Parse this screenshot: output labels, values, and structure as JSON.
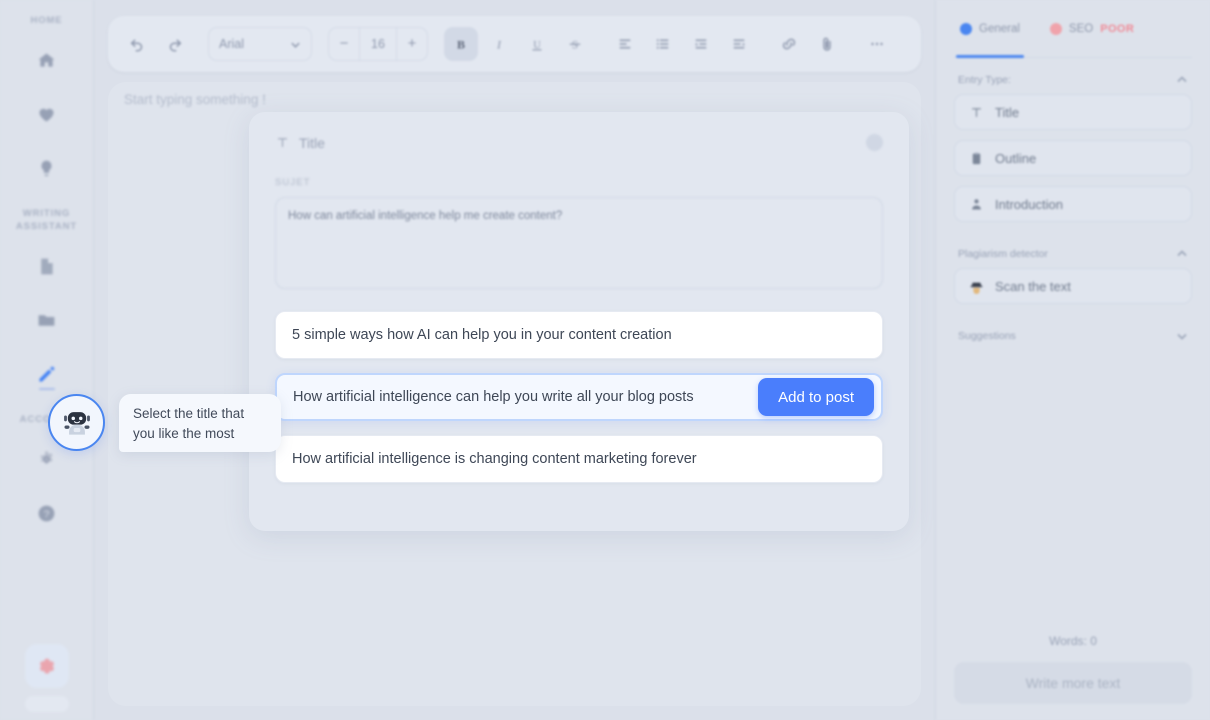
{
  "sidebar": {
    "sections": [
      {
        "label": "HOME",
        "items": [
          {
            "name": "home",
            "icon": "home-icon"
          },
          {
            "name": "favorites",
            "icon": "heart-icon"
          },
          {
            "name": "ideas",
            "icon": "bulb-icon"
          }
        ]
      },
      {
        "label": "WRITING ASSISTANT",
        "items": [
          {
            "name": "documents",
            "icon": "document-icon"
          },
          {
            "name": "folders",
            "icon": "folder-icon"
          },
          {
            "name": "editor",
            "icon": "pencil-icon",
            "active": true
          }
        ]
      },
      {
        "label": "ACCOUNT",
        "items": [
          {
            "name": "settings",
            "icon": "gear-icon"
          },
          {
            "name": "help",
            "icon": "help-icon"
          }
        ]
      }
    ]
  },
  "toolbar": {
    "undo_label": "undo",
    "redo_label": "redo",
    "font_family": "Arial",
    "font_size": "16",
    "decrease_label": "−",
    "increase_label": "+",
    "bold_label": "B",
    "italic_label": "I",
    "underline_label": "U",
    "strikethrough_label": "S",
    "items": [
      "align-left",
      "list",
      "indent",
      "outdent",
      "link",
      "attachment",
      "more"
    ]
  },
  "editor": {
    "placeholder": "Start typing something !"
  },
  "suggestion_card": {
    "header_title": "Title",
    "field_label": "SUJET",
    "prompt_value": "How can artificial intelligence help me create content?",
    "options": [
      {
        "text": "5 simple ways how AI can help you in your content creation",
        "selected": false
      },
      {
        "text": "How artificial intelligence can help you write all your blog posts",
        "selected": true
      },
      {
        "text": "How artificial intelligence is changing content marketing forever",
        "selected": false
      }
    ],
    "add_button_label": "Add to post"
  },
  "assistant": {
    "message": "Select the title that you like the most"
  },
  "right_panel": {
    "tabs": [
      {
        "label": "General",
        "active": true
      },
      {
        "label": "SEO",
        "badge": "POOR",
        "active": false
      }
    ],
    "sections": [
      {
        "title": "Entry Type:",
        "expanded": true,
        "items": [
          {
            "label": "Title",
            "icon": "title-icon"
          },
          {
            "label": "Outline",
            "icon": "outline-icon"
          },
          {
            "label": "Introduction",
            "icon": "introduction-icon"
          }
        ]
      },
      {
        "title": "Plagiarism detector",
        "expanded": true,
        "items": [
          {
            "label": "Scan the text",
            "icon": "detective-icon"
          }
        ]
      },
      {
        "title": "Suggestions",
        "expanded": false,
        "items": []
      }
    ],
    "word_count": "Words: 0",
    "write_more_label": "Write more text"
  },
  "colors": {
    "accent_blue": "#4a7efc",
    "background": "#dbe0ea",
    "card": "#e2e7f0",
    "seo_red": "#f08a96"
  }
}
